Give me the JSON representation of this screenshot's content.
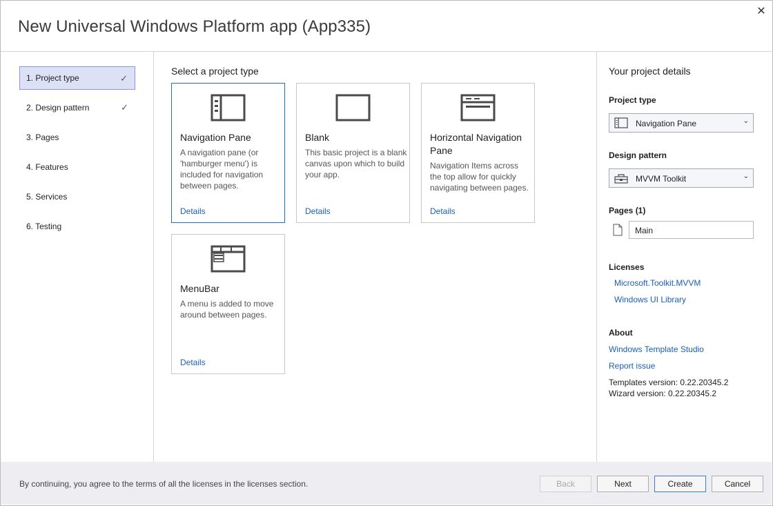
{
  "window": {
    "title": "New Universal Windows Platform app (App335)",
    "close_glyph": "✕"
  },
  "steps": [
    {
      "label": "1. Project type",
      "checked": true,
      "active": true
    },
    {
      "label": "2. Design pattern",
      "checked": true,
      "active": false
    },
    {
      "label": "3. Pages",
      "checked": false,
      "active": false
    },
    {
      "label": "4. Features",
      "checked": false,
      "active": false
    },
    {
      "label": "5. Services",
      "checked": false,
      "active": false
    },
    {
      "label": "6. Testing",
      "checked": false,
      "active": false
    }
  ],
  "check_glyph": "✓",
  "main": {
    "section_title": "Select a project type",
    "cards": [
      {
        "name": "Navigation Pane",
        "description": "A navigation pane (or 'hamburger menu') is included for navigation between pages.",
        "details": "Details",
        "icon": "navigation-pane-icon",
        "selected": true
      },
      {
        "name": "Blank",
        "description": "This basic project is a blank canvas upon which to build your app.",
        "details": "Details",
        "icon": "blank-icon",
        "selected": false
      },
      {
        "name": "Horizontal Navigation Pane",
        "description": "Navigation Items across the top allow for quickly navigating between pages.",
        "details": "Details",
        "icon": "horizontal-navigation-icon",
        "selected": false
      },
      {
        "name": "MenuBar",
        "description": "A menu is added to move around between pages.",
        "details": "Details",
        "icon": "menubar-icon",
        "selected": false
      }
    ]
  },
  "details_panel": {
    "title": "Your project details",
    "project_type_label": "Project type",
    "project_type_value": "Navigation Pane",
    "design_pattern_label": "Design pattern",
    "design_pattern_value": "MVVM Toolkit",
    "pages_label": "Pages (1)",
    "page_name": "Main",
    "licenses_label": "Licenses",
    "licenses": [
      "Microsoft.Toolkit.MVVM",
      "Windows UI Library"
    ],
    "about_label": "About",
    "about_links": [
      "Windows Template Studio",
      "Report issue"
    ],
    "templates_version": "Templates version: 0.22.20345.2",
    "wizard_version": "Wizard version: 0.22.20345.2",
    "chevron_glyph": "⌄"
  },
  "footer": {
    "notice": "By continuing, you agree to the terms of all the licenses in the licenses section.",
    "back_label": "Back",
    "next_label": "Next",
    "create_label": "Create",
    "cancel_label": "Cancel"
  },
  "colors": {
    "accent": "#1f6fc6",
    "active_step_bg": "#dce1f6",
    "link": "#1a5fb4",
    "footer_bg": "#eeeef2"
  }
}
